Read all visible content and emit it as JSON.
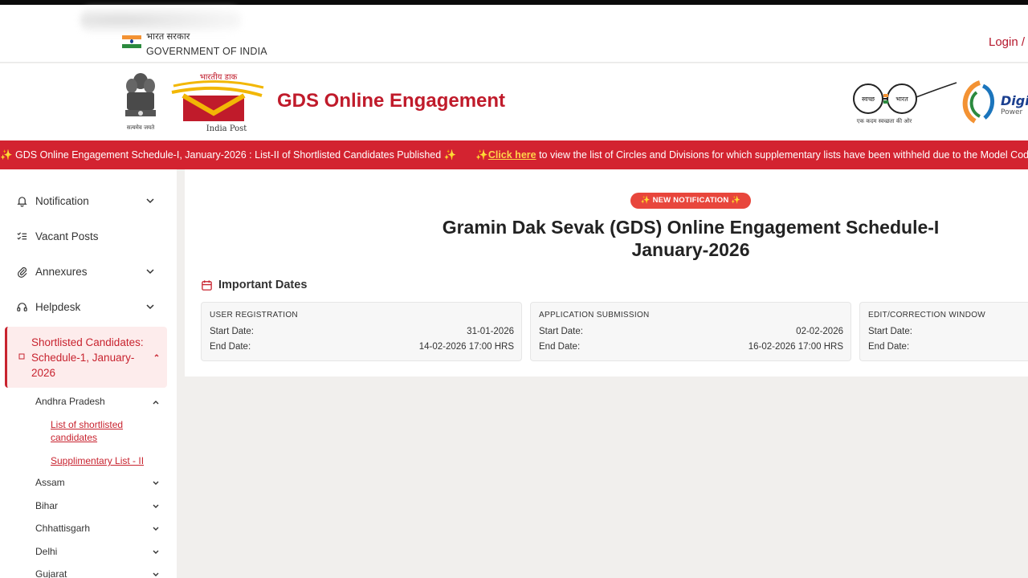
{
  "govbar": {
    "hindi": "भारत सरकार",
    "english": "GOVERNMENT OF INDIA",
    "login": "Login /"
  },
  "header": {
    "title": "GDS Online Engagement",
    "emblem_caption": "सत्यमेव जयते",
    "indiapost_hindi": "भारतीय डाक",
    "indiapost_en": "India Post",
    "swachh_left": "स्वच्छ",
    "swachh_right": "भारत",
    "swachh_caption": "एक कदम स्वच्छता की ओर",
    "digital_top": "Digi",
    "digital_bottom": "Power"
  },
  "ticker": {
    "item1": "✨ GDS Online Engagement Schedule-I, January-2026 : List-II of Shortlisted Candidates Published ✨",
    "item2_prefix": "✨",
    "item2_link": "Click here",
    "item2_rest": "to view the list of Circles and Divisions for which supplementary lists have been withheld due to the Model Cod"
  },
  "sidebar": {
    "items": [
      {
        "label": "Notification"
      },
      {
        "label": "Vacant Posts"
      },
      {
        "label": "Annexures"
      },
      {
        "label": "Helpdesk"
      }
    ],
    "active": "Shortlisted Candidates: Schedule-1, January-2026",
    "state": "Andhra Pradesh",
    "links": [
      "List of shortlisted candidates",
      "Supplimentary List - II"
    ],
    "states": [
      "Assam",
      "Bihar",
      "Chhattisgarh",
      "Delhi",
      "Gujarat"
    ]
  },
  "main": {
    "badge": "✨ NEW NOTIFICATION ✨",
    "title_line1": "Gramin Dak Sevak (GDS) Online Engagement Schedule-I",
    "title_line2": "January-2026",
    "section": "Important Dates",
    "cards": [
      {
        "heading": "USER REGISTRATION",
        "start_label": "Start Date:",
        "start": "31-01-2026",
        "end_label": "End Date:",
        "end": "14-02-2026 17:00 HRS"
      },
      {
        "heading": "APPLICATION SUBMISSION",
        "start_label": "Start Date:",
        "start": "02-02-2026",
        "end_label": "End Date:",
        "end": "16-02-2026 17:00 HRS"
      },
      {
        "heading": "EDIT/CORRECTION WINDOW",
        "start_label": "Start Date:",
        "start": "",
        "end_label": "End Date:",
        "end": ""
      }
    ]
  },
  "colors": {
    "brand_red": "#c01b2b",
    "ticker_bg": "#d32330",
    "ticker_link": "#ffd34a",
    "badge_bg": "#e8463c"
  }
}
